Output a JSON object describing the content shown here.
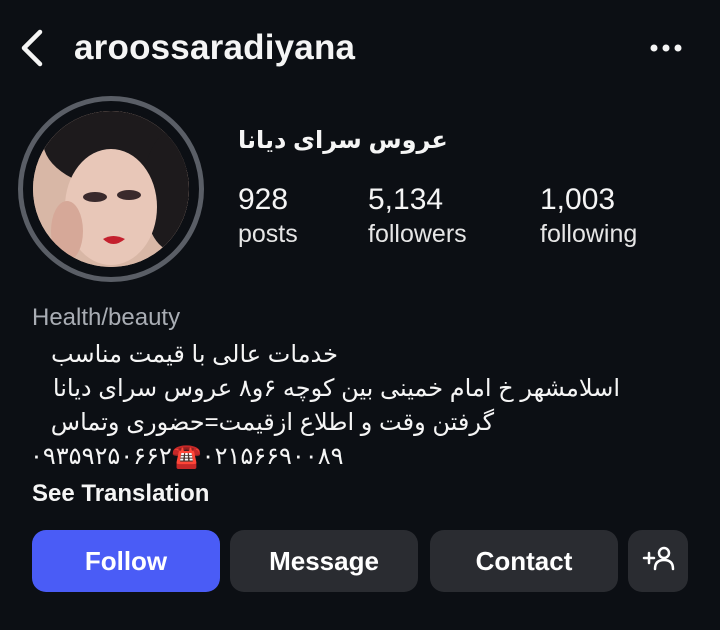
{
  "header": {
    "username": "aroossaradiyana"
  },
  "profile": {
    "full_name": "عروس سرای دیانا",
    "stats": [
      {
        "value": "928",
        "label": "posts"
      },
      {
        "value": "5,134",
        "label": "followers"
      },
      {
        "value": "1,003",
        "label": "following"
      }
    ],
    "category": "Health/beauty",
    "bio_lines": [
      "خدمات عالی با قیمت مناسب",
      "اسلامشهر خ امام خمینی بین کوچه ۶و۸ عروس سرای دیانا",
      "گرفتن وقت و اطلاع ازقیمت=حضوری وتماس",
      "۰۹۳۵۹۲۵۰۶۶۲☎️۰۲۱۵۶۶۹۰۰۸۹"
    ],
    "see_translation": "See Translation"
  },
  "actions": {
    "follow": "Follow",
    "message": "Message",
    "contact": "Contact"
  },
  "colors": {
    "background": "#0c0f14",
    "follow_button": "#4a5cf6",
    "secondary_button": "#2a2c31",
    "muted_text": "#a9adb4"
  },
  "icons": [
    "back-chevron-icon",
    "more-options-icon",
    "add-person-icon"
  ]
}
